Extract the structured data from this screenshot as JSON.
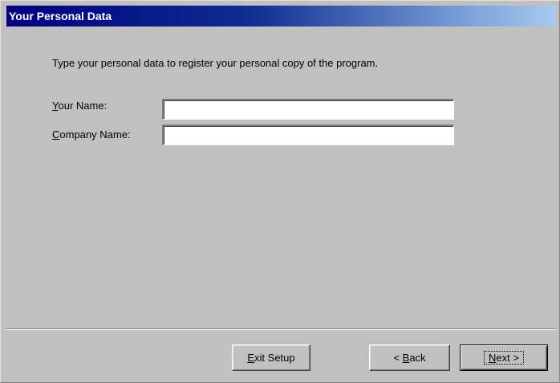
{
  "window": {
    "title": "Your Personal Data"
  },
  "intro_text": "Type your personal data to register your personal copy of the program.",
  "fields": {
    "name": {
      "label_access": "Y",
      "label_rest": "our Name:",
      "value": ""
    },
    "company": {
      "label_access": "C",
      "label_rest": "ompany Name:",
      "value": ""
    }
  },
  "buttons": {
    "exit": {
      "access": "E",
      "rest": "xit Setup"
    },
    "back": {
      "prefix": "< ",
      "access": "B",
      "rest": "ack"
    },
    "next": {
      "access": "N",
      "rest": "ext >"
    }
  },
  "colors": {
    "face": "#c0c0c0",
    "title_start": "#00007f",
    "title_end": "#a6caf0"
  }
}
